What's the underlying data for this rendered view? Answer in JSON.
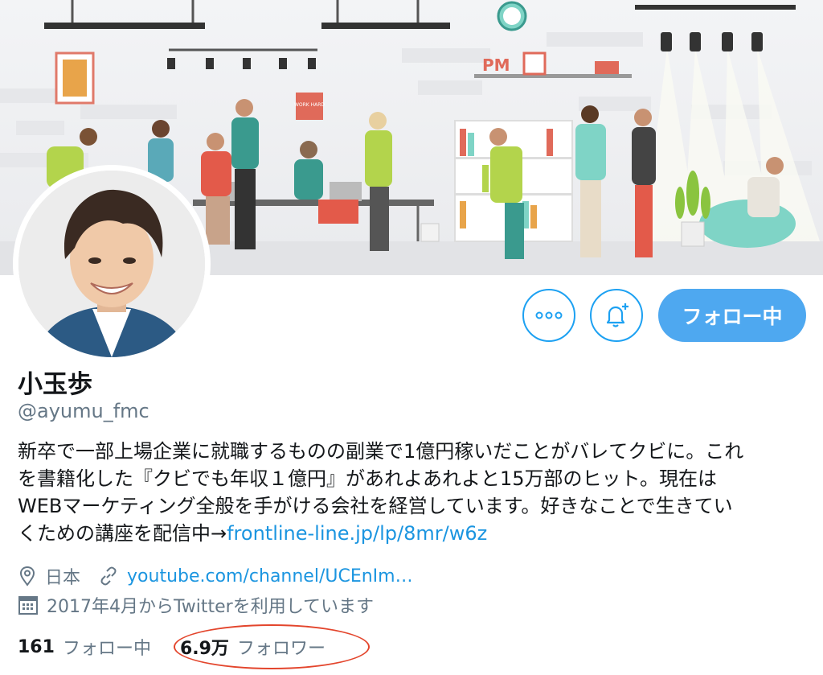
{
  "profile": {
    "name": "小玉歩",
    "handle": "@ayumu_fmc",
    "bio_lines": [
      "新卒で一部上場企業に就職するものの副業で1億円稼いだことがバレてクビに。これ",
      "を書籍化した『クビでも年収１億円』があれよあれよと15万部のヒット。現在は",
      "WEBマーケティング全般を手がける会社を経営しています。好きなことで生きてい",
      "くための講座を配信中→"
    ],
    "bio_link": "frontline-line.jp/lp/8mr/w6z",
    "location": "日本",
    "website": "youtube.com/channel/UCEnIm…",
    "joined": "2017年4月からTwitterを利用しています"
  },
  "actions": {
    "more_icon": "more-icon",
    "notify_icon": "bell-plus-icon",
    "follow_label": "フォロー中"
  },
  "stats": {
    "following_count": "161",
    "following_label": "フォロー中",
    "followers_count": "6.9万",
    "followers_label": "フォロワー"
  },
  "colors": {
    "accent": "#1da1f2",
    "link": "#1b95e0",
    "secondary_text": "#657786",
    "highlight_circle": "#e3452c"
  },
  "banner": {
    "sign_text": "WORK HARD",
    "shelf_letters": "PM"
  }
}
